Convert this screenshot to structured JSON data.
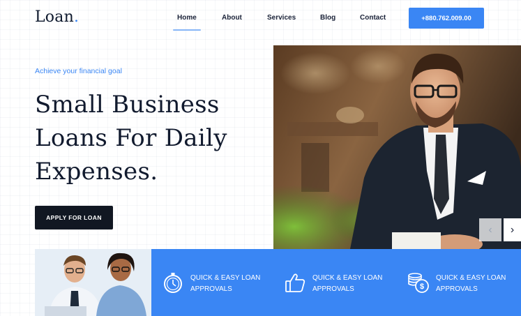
{
  "brand": {
    "name": "Loan",
    "dot": "."
  },
  "nav": {
    "items": [
      {
        "label": "Home",
        "active": true
      },
      {
        "label": "About",
        "active": false
      },
      {
        "label": "Services",
        "active": false
      },
      {
        "label": "Blog",
        "active": false
      },
      {
        "label": "Contact",
        "active": false
      }
    ],
    "phone": "+880.762.009.00"
  },
  "hero": {
    "eyebrow": "Achieve your financial goal",
    "headline": "Small Business Loans For Daily Expenses.",
    "cta_label": "APPLY FOR LOAN",
    "prev_arrow": "‹",
    "next_arrow": "›"
  },
  "features": [
    {
      "icon": "stopwatch-icon",
      "text": "QUICK & EASY LOAN APPROVALS"
    },
    {
      "icon": "thumbs-up-icon",
      "text": "QUICK & EASY LOAN APPROVALS"
    },
    {
      "icon": "coins-icon",
      "text": "QUICK & EASY LOAN APPROVALS"
    }
  ],
  "colors": {
    "accent": "#3a86f4",
    "dark": "#111722",
    "heading": "#111a2e"
  }
}
